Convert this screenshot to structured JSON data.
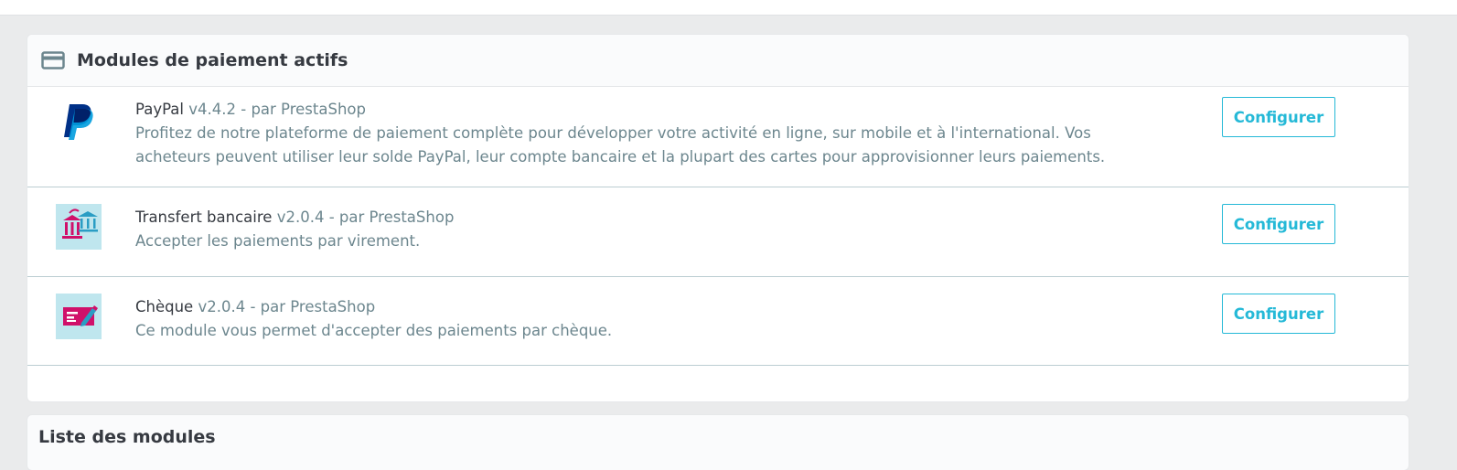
{
  "active_panel": {
    "title": "Modules de paiement actifs",
    "modules": [
      {
        "name": "PayPal",
        "meta": "v4.4.2 - par PrestaShop",
        "description": "Profitez de notre plateforme de paiement complète pour développer votre activité en ligne, sur mobile et à l'international. Vos acheteurs peuvent utiliser leur solde PayPal, leur compte bancaire et la plupart des cartes pour approvisionner leurs paiements.",
        "button": "Configurer",
        "icon": "paypal-logo"
      },
      {
        "name": "Transfert bancaire",
        "meta": "v2.0.4 - par PrestaShop",
        "description": "Accepter les paiements par virement.",
        "button": "Configurer",
        "icon": "bank-transfer-logo"
      },
      {
        "name": "Chèque",
        "meta": "v2.0.4 - par PrestaShop",
        "description": "Ce module vous permet d'accepter des paiements par chèque.",
        "button": "Configurer",
        "icon": "cheque-logo"
      }
    ]
  },
  "modules_list_panel": {
    "title": "Liste des modules"
  },
  "colors": {
    "accent": "#25b9d7",
    "text_dark": "#363a41",
    "text_muted": "#6c868e",
    "paypal_dark": "#003087",
    "paypal_light": "#009cde",
    "logo_bg": "#bfe6ee",
    "logo_magenta": "#d0106a"
  }
}
